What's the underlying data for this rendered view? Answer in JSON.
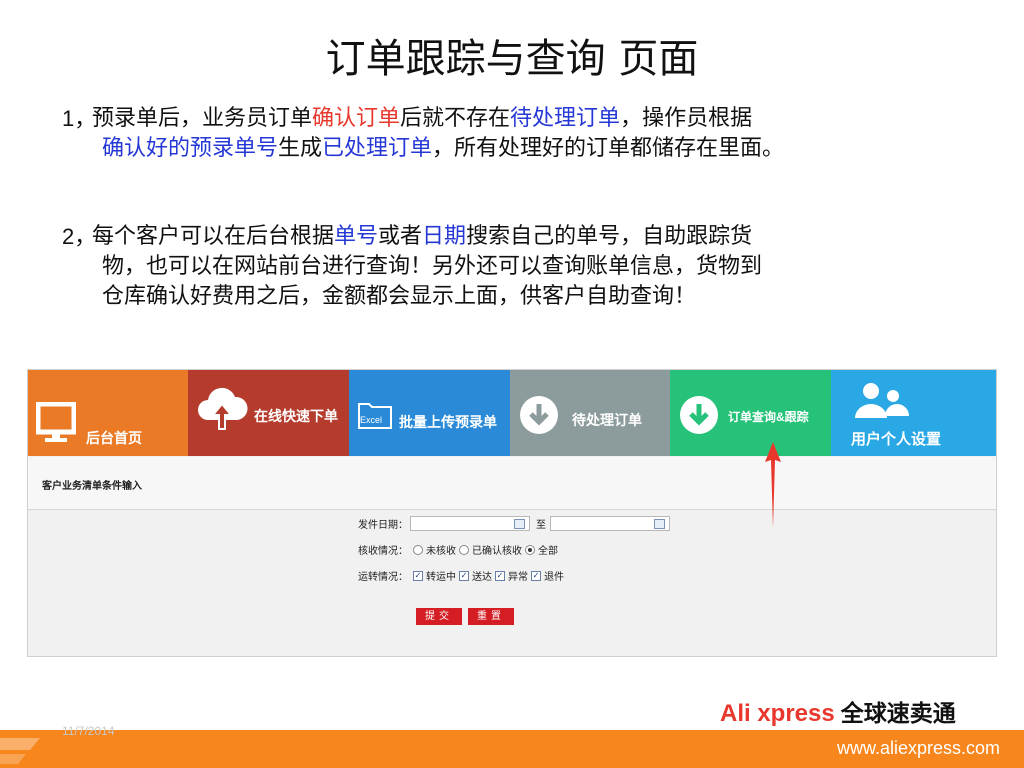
{
  "slide": {
    "title": "订单跟踪与查询  页面",
    "p1": {
      "num": "1，",
      "l1a": "预录单后，业务员订单",
      "l1b": "确认订单",
      "l1c": "后就不存在",
      "l1d": "待处理订单",
      "l1e": "，操作员根据",
      "l2a": "确认好的预录单号",
      "l2b": "生成",
      "l2c": "已处理订单",
      "l2d": "，所有处理好的订单都储存在里面。"
    },
    "p2": {
      "num": "2，",
      "l1a": "每个客户可以在后台根据",
      "l1b": "单号",
      "l1c": "或者",
      "l1d": "日期",
      "l1e": "搜索自己的单号，自助跟踪货",
      "l2": "物，也可以在网站前台进行查询！另外还可以查询账单信息，货物到",
      "l3": "仓库确认好费用之后，金额都会显示上面，供客户自助查询！"
    },
    "date": "11/7/2014",
    "brand_en": "Ali xpress",
    "brand_cn": "全球速卖通",
    "url": "www.aliexpress.com"
  },
  "nav": {
    "home": "后台首页",
    "online": "在线快速下单",
    "batch": "批量上传预录单",
    "excel_tag": "Excel",
    "pending": "待处理订单",
    "track": "订单查询&跟踪",
    "user": "用户个人设置"
  },
  "form": {
    "section_title": "客户业务清单条件输入",
    "ship_date_label": "发件日期：",
    "to_label": "至",
    "verify_label": "核收情况：",
    "verify_opt1": "未核收",
    "verify_opt2": "已确认核收",
    "verify_opt3": "全部",
    "transit_label": "运转情况：",
    "transit_opt1": "转运中",
    "transit_opt2": "送达",
    "transit_opt3": "异常",
    "transit_opt4": "退件",
    "submit": "提交",
    "reset": "重置"
  },
  "colors": {
    "home": "#ea7a25",
    "online": "#b53b2c",
    "batch": "#2a8ad7",
    "pending": "#8c9b9c",
    "track": "#27c27a",
    "user": "#2aa8e5",
    "accent_red": "#e8382d",
    "accent_blue": "#2538d6",
    "footer": "#f7861c"
  }
}
